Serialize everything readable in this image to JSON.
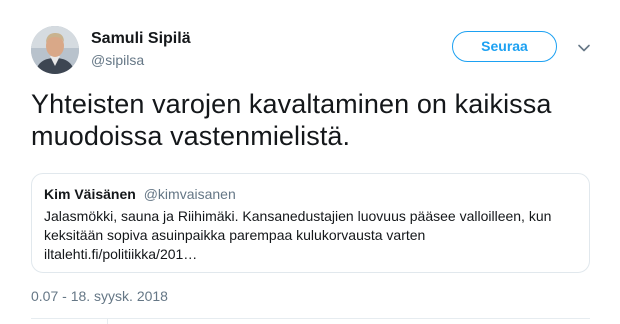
{
  "author": {
    "name": "Samuli Sipilä",
    "handle": "@sipilsa"
  },
  "actions": {
    "follow_label": "Seuraa",
    "more_icon": "chevron-down-icon"
  },
  "tweet": {
    "text": "Yhteisten varojen kavaltaminen on kaikissa muodoissa vastenmielistä.",
    "timestamp": "0.07 - 18. syysk. 2018"
  },
  "quoted_tweet": {
    "name": "Kim Väisänen",
    "handle": "@kimvaisanen",
    "lines": [
      "Jalasmökki, sauna ja Riihimäki. Kansanedustajien luovuus pääsee valloilleen, kun",
      "keksitään sopiva asuinpaikka parempaa kulukorvausta varten",
      "iltalehti.fi/politiikka/201…"
    ]
  },
  "colors": {
    "accent": "#1da1f2",
    "text": "#14171a",
    "secondary_text": "#657786",
    "border": "#e1e8ed"
  }
}
